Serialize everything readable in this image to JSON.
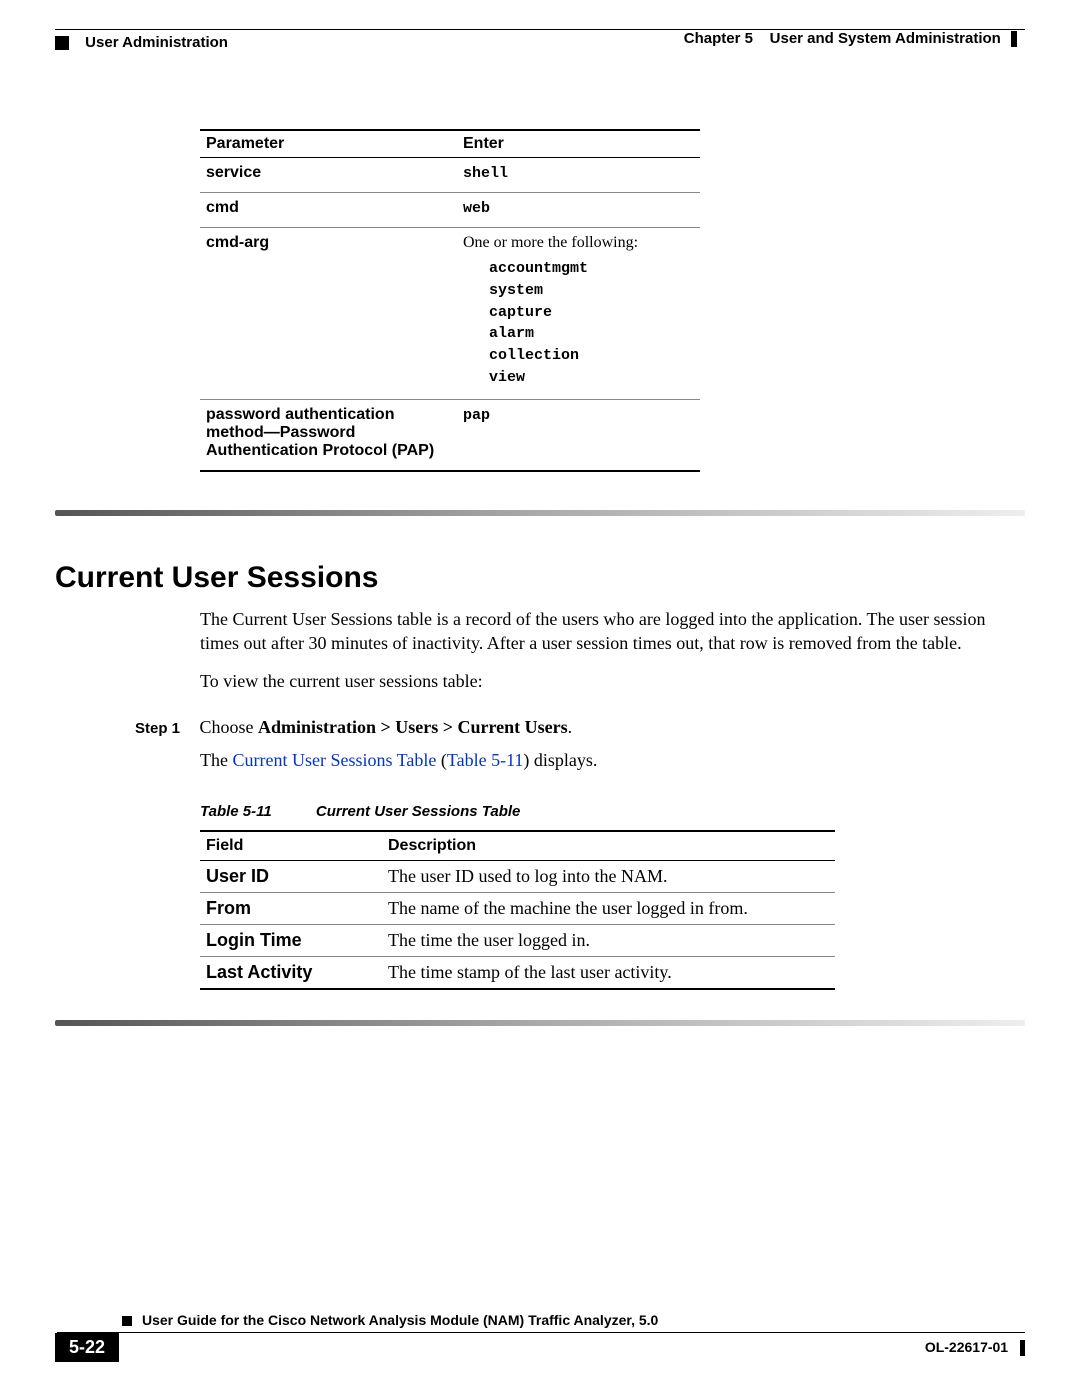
{
  "header": {
    "chapter_label": "Chapter 5",
    "chapter_title": "User and System Administration",
    "section": "User Administration"
  },
  "param_table": {
    "headers": {
      "parameter": "Parameter",
      "enter": "Enter"
    },
    "rows": {
      "service": {
        "param": "service",
        "enter": "shell"
      },
      "cmd": {
        "param": "cmd",
        "enter": "web"
      },
      "cmdarg": {
        "param": "cmd-arg",
        "intro": "One or more the following:",
        "opts": [
          "accountmgmt",
          "system",
          "capture",
          "alarm",
          "collection",
          "view"
        ]
      },
      "pap": {
        "param": "password authentication method—Password Authentication Protocol (PAP)",
        "enter": "pap"
      }
    }
  },
  "heading": "Current User Sessions",
  "para1": "The Current User Sessions table is a record of the users who are logged into the application. The user session times out after 30 minutes of inactivity. After a user session times out, that row is removed from the table.",
  "para2": "To view the current user sessions table:",
  "step": {
    "label": "Step 1",
    "prefix": "Choose ",
    "bold": "Administration > Users > Current Users",
    "suffix": "."
  },
  "step_follow": {
    "pre": "The ",
    "link1": "Current User Sessions Table",
    "mid": " (",
    "link2": "Table 5-11",
    "post": ") displays."
  },
  "table_caption": {
    "num": "Table 5-11",
    "title": "Current User Sessions Table"
  },
  "field_table": {
    "headers": {
      "field": "Field",
      "desc": "Description"
    },
    "rows": [
      {
        "field": "User ID",
        "desc": "The user ID used to log into the NAM."
      },
      {
        "field": "From",
        "desc": "The name of the machine the user logged in from."
      },
      {
        "field": "Login Time",
        "desc": "The time the user logged in."
      },
      {
        "field": "Last Activity",
        "desc": "The time stamp of the last user activity."
      }
    ]
  },
  "footer": {
    "title": "User Guide for the Cisco Network Analysis Module (NAM) Traffic Analyzer, 5.0",
    "page": "5-22",
    "docnum": "OL-22617-01"
  }
}
